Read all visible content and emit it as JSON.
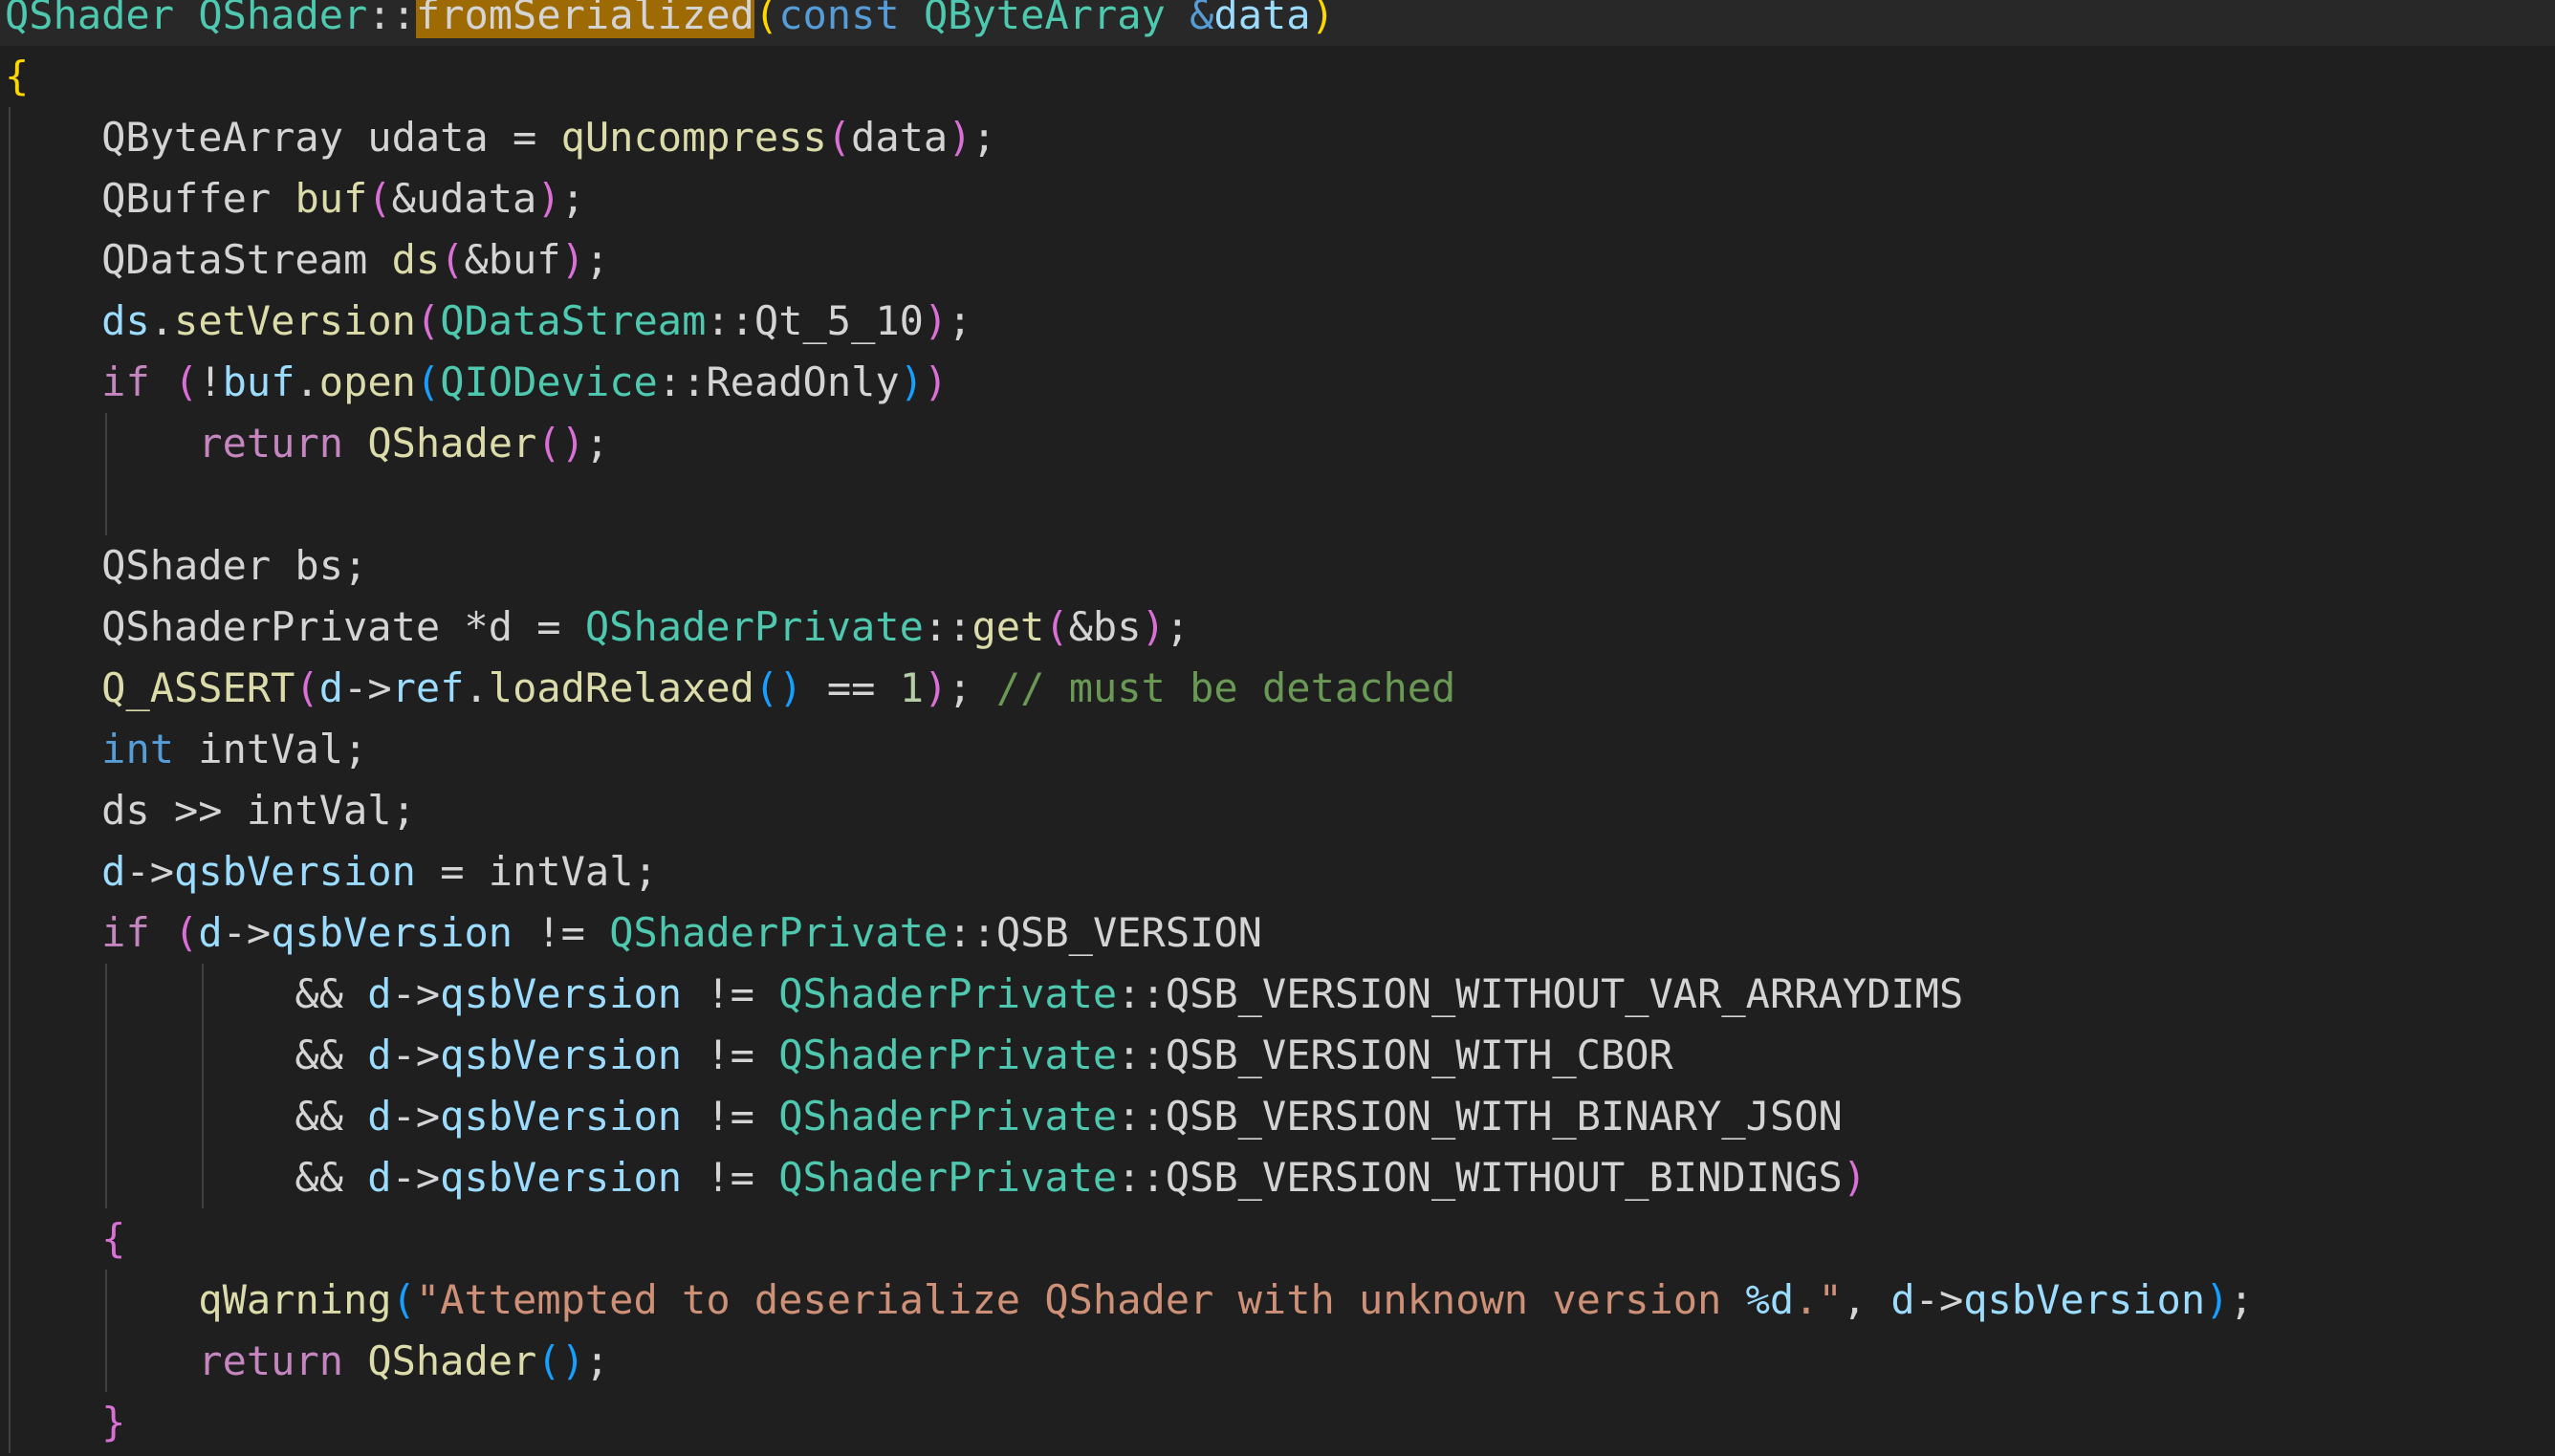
{
  "editor": {
    "language": "cpp",
    "highlight_word": "fromSerialized",
    "colors": {
      "background": "#1f1f1f",
      "current_line": "#282828",
      "plain": "#d4d4d4",
      "type": "#4ec9b0",
      "function": "#dcdcaa",
      "keyword": "#569cd6",
      "control": "#c586c0",
      "variable": "#9cdcfe",
      "number": "#b5cea8",
      "string": "#ce9178",
      "comment": "#6a9955",
      "bracket_level_1": "#ffd700",
      "bracket_level_2": "#da70d6",
      "bracket_level_3": "#179fff",
      "find_highlight": "#9e6a03"
    },
    "lines": [
      [
        [
          "type",
          "QShader"
        ],
        [
          "plain",
          " "
        ],
        [
          "type",
          "QShader"
        ],
        [
          "plain",
          "::"
        ],
        [
          "hl",
          "fromSerialized"
        ],
        [
          "b1",
          "("
        ],
        [
          "kw",
          "const"
        ],
        [
          "plain",
          " "
        ],
        [
          "type",
          "QByteArray"
        ],
        [
          "plain",
          " "
        ],
        [
          "kw",
          "&"
        ],
        [
          "var",
          "data"
        ],
        [
          "b1",
          ")"
        ]
      ],
      [
        [
          "b1",
          "{"
        ]
      ],
      [
        [
          "plain",
          "    QByteArray udata = "
        ],
        [
          "func",
          "qUncompress"
        ],
        [
          "b2",
          "("
        ],
        [
          "plain",
          "data"
        ],
        [
          "b2",
          ")"
        ],
        [
          "plain",
          ";"
        ]
      ],
      [
        [
          "plain",
          "    QBuffer "
        ],
        [
          "func",
          "buf"
        ],
        [
          "b2",
          "("
        ],
        [
          "plain",
          "&udata"
        ],
        [
          "b2",
          ")"
        ],
        [
          "plain",
          ";"
        ]
      ],
      [
        [
          "plain",
          "    QDataStream "
        ],
        [
          "func",
          "ds"
        ],
        [
          "b2",
          "("
        ],
        [
          "plain",
          "&buf"
        ],
        [
          "b2",
          ")"
        ],
        [
          "plain",
          ";"
        ]
      ],
      [
        [
          "plain",
          "    "
        ],
        [
          "var",
          "ds"
        ],
        [
          "plain",
          "."
        ],
        [
          "func",
          "setVersion"
        ],
        [
          "b2",
          "("
        ],
        [
          "type",
          "QDataStream"
        ],
        [
          "plain",
          "::Qt_5_10"
        ],
        [
          "b2",
          ")"
        ],
        [
          "plain",
          ";"
        ]
      ],
      [
        [
          "plain",
          "    "
        ],
        [
          "ctl",
          "if"
        ],
        [
          "plain",
          " "
        ],
        [
          "b2",
          "("
        ],
        [
          "plain",
          "!"
        ],
        [
          "var",
          "buf"
        ],
        [
          "plain",
          "."
        ],
        [
          "func",
          "open"
        ],
        [
          "b3",
          "("
        ],
        [
          "type",
          "QIODevice"
        ],
        [
          "plain",
          "::ReadOnly"
        ],
        [
          "b3",
          ")"
        ],
        [
          "b2",
          ")"
        ]
      ],
      [
        [
          "plain",
          "        "
        ],
        [
          "ctl",
          "return"
        ],
        [
          "plain",
          " "
        ],
        [
          "func",
          "QShader"
        ],
        [
          "b2",
          "("
        ],
        [
          "b2",
          ")"
        ],
        [
          "plain",
          ";"
        ]
      ],
      [],
      [
        [
          "plain",
          "    QShader bs;"
        ]
      ],
      [
        [
          "plain",
          "    QShaderPrivate *d = "
        ],
        [
          "type",
          "QShaderPrivate"
        ],
        [
          "plain",
          "::"
        ],
        [
          "func",
          "get"
        ],
        [
          "b2",
          "("
        ],
        [
          "plain",
          "&bs"
        ],
        [
          "b2",
          ")"
        ],
        [
          "plain",
          ";"
        ]
      ],
      [
        [
          "plain",
          "    "
        ],
        [
          "func",
          "Q_ASSERT"
        ],
        [
          "b2",
          "("
        ],
        [
          "var",
          "d"
        ],
        [
          "plain",
          "->"
        ],
        [
          "var",
          "ref"
        ],
        [
          "plain",
          "."
        ],
        [
          "func",
          "loadRelaxed"
        ],
        [
          "b3",
          "("
        ],
        [
          "b3",
          ")"
        ],
        [
          "plain",
          " == "
        ],
        [
          "num",
          "1"
        ],
        [
          "b2",
          ")"
        ],
        [
          "plain",
          "; "
        ],
        [
          "cmt",
          "// must be detached"
        ]
      ],
      [
        [
          "plain",
          "    "
        ],
        [
          "kw",
          "int"
        ],
        [
          "plain",
          " intVal;"
        ]
      ],
      [
        [
          "plain",
          "    ds >> intVal;"
        ]
      ],
      [
        [
          "plain",
          "    "
        ],
        [
          "var",
          "d"
        ],
        [
          "plain",
          "->"
        ],
        [
          "var",
          "qsbVersion"
        ],
        [
          "plain",
          " = intVal;"
        ]
      ],
      [
        [
          "plain",
          "    "
        ],
        [
          "ctl",
          "if"
        ],
        [
          "plain",
          " "
        ],
        [
          "b2",
          "("
        ],
        [
          "var",
          "d"
        ],
        [
          "plain",
          "->"
        ],
        [
          "var",
          "qsbVersion"
        ],
        [
          "plain",
          " != "
        ],
        [
          "type",
          "QShaderPrivate"
        ],
        [
          "plain",
          "::QSB_VERSION"
        ]
      ],
      [
        [
          "plain",
          "            && "
        ],
        [
          "var",
          "d"
        ],
        [
          "plain",
          "->"
        ],
        [
          "var",
          "qsbVersion"
        ],
        [
          "plain",
          " != "
        ],
        [
          "type",
          "QShaderPrivate"
        ],
        [
          "plain",
          "::QSB_VERSION_WITHOUT_VAR_ARRAYDIMS"
        ]
      ],
      [
        [
          "plain",
          "            && "
        ],
        [
          "var",
          "d"
        ],
        [
          "plain",
          "->"
        ],
        [
          "var",
          "qsbVersion"
        ],
        [
          "plain",
          " != "
        ],
        [
          "type",
          "QShaderPrivate"
        ],
        [
          "plain",
          "::QSB_VERSION_WITH_CBOR"
        ]
      ],
      [
        [
          "plain",
          "            && "
        ],
        [
          "var",
          "d"
        ],
        [
          "plain",
          "->"
        ],
        [
          "var",
          "qsbVersion"
        ],
        [
          "plain",
          " != "
        ],
        [
          "type",
          "QShaderPrivate"
        ],
        [
          "plain",
          "::QSB_VERSION_WITH_BINARY_JSON"
        ]
      ],
      [
        [
          "plain",
          "            && "
        ],
        [
          "var",
          "d"
        ],
        [
          "plain",
          "->"
        ],
        [
          "var",
          "qsbVersion"
        ],
        [
          "plain",
          " != "
        ],
        [
          "type",
          "QShaderPrivate"
        ],
        [
          "plain",
          "::QSB_VERSION_WITHOUT_BINDINGS"
        ],
        [
          "b2",
          ")"
        ]
      ],
      [
        [
          "plain",
          "    "
        ],
        [
          "b2",
          "{"
        ]
      ],
      [
        [
          "plain",
          "        "
        ],
        [
          "func",
          "qWarning"
        ],
        [
          "b3",
          "("
        ],
        [
          "str",
          "\"Attempted to deserialize QShader with unknown version "
        ],
        [
          "esc",
          "%d"
        ],
        [
          "str",
          ".\""
        ],
        [
          "plain",
          ", "
        ],
        [
          "var",
          "d"
        ],
        [
          "plain",
          "->"
        ],
        [
          "var",
          "qsbVersion"
        ],
        [
          "b3",
          ")"
        ],
        [
          "plain",
          ";"
        ]
      ],
      [
        [
          "plain",
          "        "
        ],
        [
          "ctl",
          "return"
        ],
        [
          "plain",
          " "
        ],
        [
          "func",
          "QShader"
        ],
        [
          "b3",
          "("
        ],
        [
          "b3",
          ")"
        ],
        [
          "plain",
          ";"
        ]
      ],
      [
        [
          "plain",
          "    "
        ],
        [
          "b2",
          "}"
        ]
      ]
    ]
  }
}
